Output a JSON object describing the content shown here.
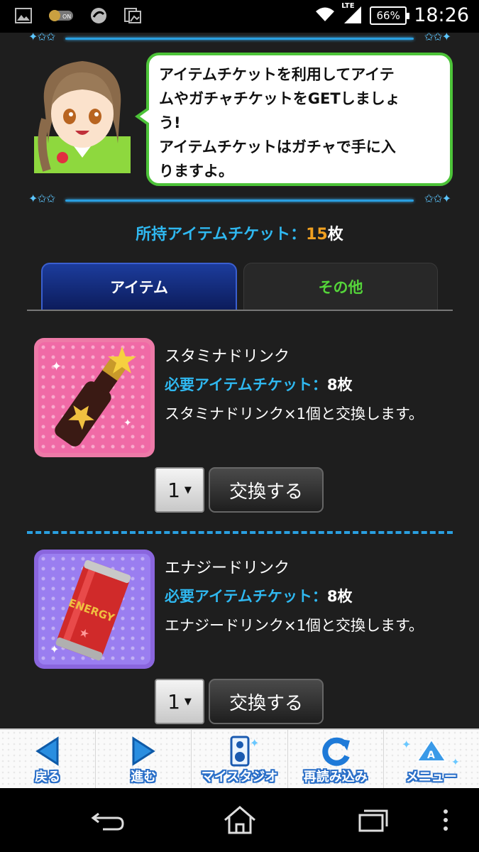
{
  "status_bar": {
    "network": "LTE",
    "battery": "66%",
    "time": "18:26",
    "icons": [
      "image-icon",
      "toggle-on-icon",
      "sync-icon",
      "photos-icon",
      "wifi-icon",
      "signal-icon",
      "battery-icon"
    ]
  },
  "speech": {
    "text": "アイテムチケットを利用してアイテ\nムやガチャチケットをGETしましょ\nう!\nアイテムチケットはガチャで手に入\nりますよ。"
  },
  "ticket_count": {
    "label": "所持アイテムチケット：",
    "value": "15",
    "unit": "枚"
  },
  "tabs": [
    {
      "label": "アイテム",
      "active": true
    },
    {
      "label": "その他",
      "active": false
    }
  ],
  "items": [
    {
      "name": "スタミナドリンク",
      "req_label": "必要アイテムチケット：",
      "req_value": "8枚",
      "description": "スタミナドリンク×1個と交換します。",
      "quantity": "1",
      "button": "交換する",
      "frame_color": "#e86aa0",
      "bg_color": "#f27ab0",
      "icon": "stamina-drink-icon"
    },
    {
      "name": "エナジードリンク",
      "req_label": "必要アイテムチケット：",
      "req_value": "8枚",
      "description": "エナジードリンク×1個と交換します。",
      "quantity": "1",
      "button": "交換する",
      "frame_color": "#8a6ae0",
      "bg_color": "#9a7ef0",
      "icon": "energy-drink-icon",
      "can_text": "ENERGY"
    }
  ],
  "bottom_nav": [
    {
      "label": "戻る",
      "icon": "back-arrow-icon"
    },
    {
      "label": "進む",
      "icon": "forward-arrow-icon"
    },
    {
      "label": "マイスタジオ",
      "icon": "speaker-icon"
    },
    {
      "label": "再読み込み",
      "icon": "reload-icon"
    },
    {
      "label": "メニュー",
      "icon": "menu-logo-icon"
    }
  ],
  "colors": {
    "accent_blue": "#2fb8f0",
    "count_orange": "#f0a020",
    "tab_green": "#55d63a",
    "bubble_border": "#4cc338"
  }
}
